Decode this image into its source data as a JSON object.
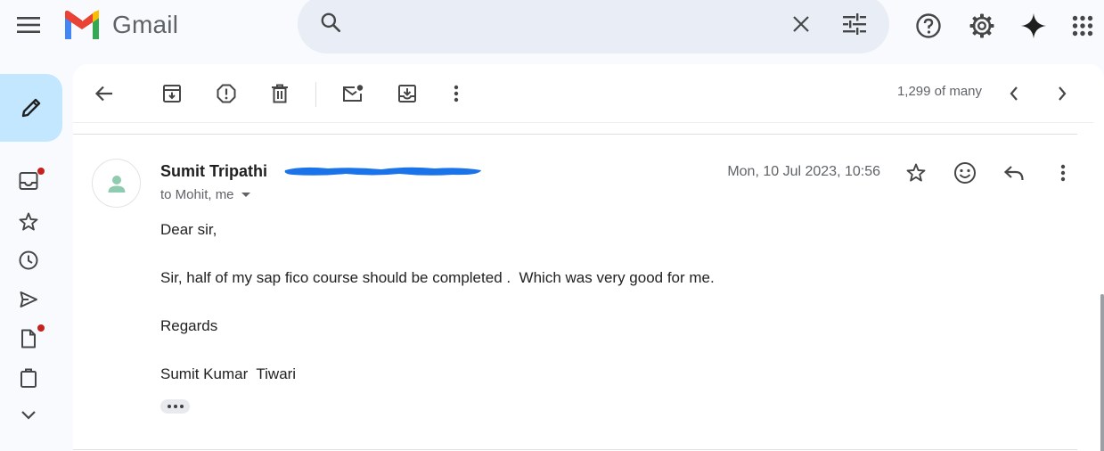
{
  "app": {
    "name": "Gmail"
  },
  "search": {
    "placeholder": "",
    "value": ""
  },
  "toolbar": {
    "count": "1,299 of many"
  },
  "message": {
    "sender_name": "Sumit Tripathi",
    "recipients": "to Mohit, me",
    "date": "Mon, 10 Jul 2023, 10:56",
    "body": [
      "Dear sir,",
      "Sir, half of my sap fico course should be completed .  Which was very good for me.",
      "Regards",
      "Sumit Kumar  Tiwari"
    ]
  },
  "colors": {
    "compose_bg": "#c2e7ff",
    "search_bg": "#e9eef6",
    "badge_red": "#c5221f",
    "redaction_blue": "#1a73e8",
    "avatar_green": "#8ecbb0"
  },
  "icons": {
    "rail": [
      "inbox-icon",
      "star-icon",
      "clock-icon",
      "send-icon",
      "draft-icon",
      "clipboard-icon",
      "chevron-down-icon"
    ],
    "toolbar": [
      "back-arrow-icon",
      "archive-icon",
      "report-spam-icon",
      "delete-icon",
      "mark-unread-icon",
      "move-to-icon",
      "more-vert-icon",
      "chevron-left-icon",
      "chevron-right-icon"
    ],
    "top": [
      "menu-icon",
      "gmail-logo",
      "search-icon",
      "close-icon",
      "tune-icon",
      "help-icon",
      "settings-icon",
      "gemini-icon",
      "apps-grid-icon"
    ]
  }
}
